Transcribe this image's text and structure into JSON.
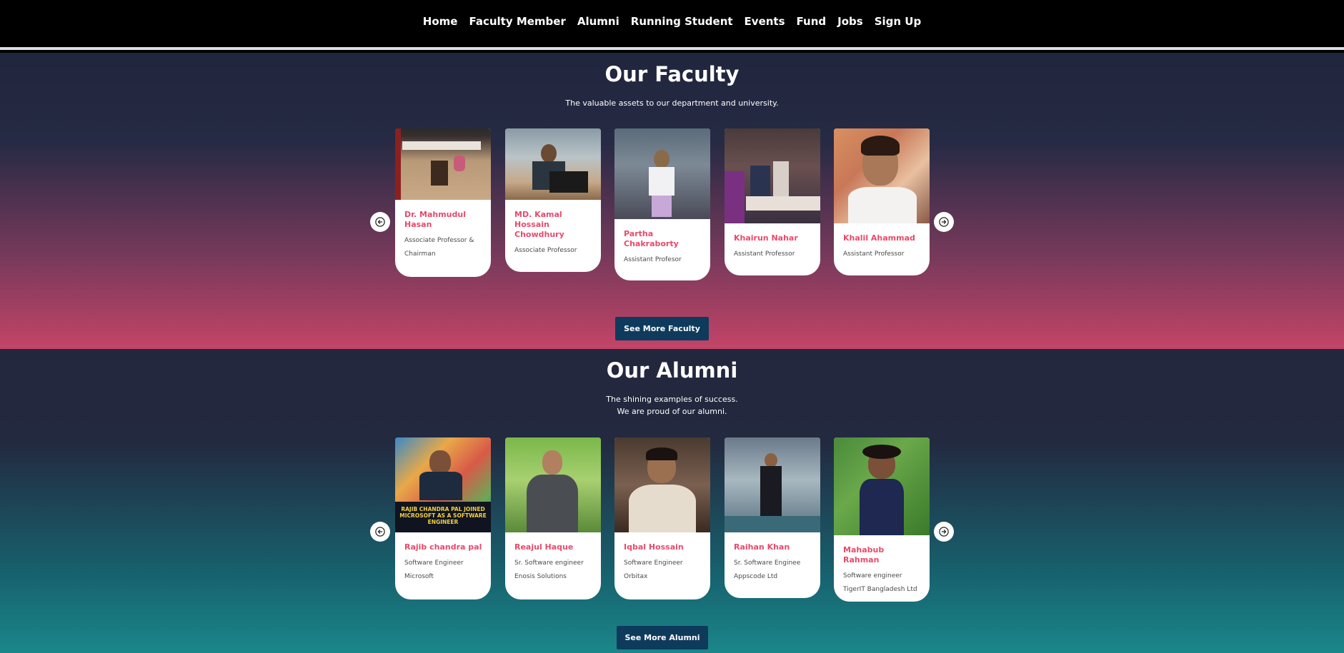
{
  "nav": {
    "items": [
      "Home",
      "Faculty Member",
      "Alumni",
      "Running Student",
      "Events",
      "Fund",
      "Jobs",
      "Sign Up"
    ]
  },
  "faculty": {
    "title": "Our Faculty",
    "subtitle": "The valuable assets to our department and university.",
    "members": [
      {
        "name": "Dr. Mahmudul Hasan",
        "role": "Associate Professor & Chairman"
      },
      {
        "name": "MD. Kamal Hossain Chowdhury",
        "role": "Associate Professor"
      },
      {
        "name": "Partha Chakraborty",
        "role": "Assistant Profesor"
      },
      {
        "name": "Khairun Nahar",
        "role": "Assistant Professor"
      },
      {
        "name": "Khalil Ahammad",
        "role": "Assistant Professor"
      }
    ],
    "button": "See More Faculty"
  },
  "alumni": {
    "title": "Our Alumni",
    "subtitle_line1": "The shining examples of success.",
    "subtitle_line2": "We are proud of our alumni.",
    "members": [
      {
        "name": "Rajib chandra pal",
        "role": "Software Engineer",
        "org": "Microsoft",
        "photo_caption": "RAJIB CHANDRA PAL JOINED MICROSOFT AS A SOFTWARE ENGINEER"
      },
      {
        "name": "Reajul Haque",
        "role": "Sr. Software engineer",
        "org": "Enosis Solutions"
      },
      {
        "name": "Iqbal Hossain",
        "role": "Software Engineer",
        "org": "Orbitax"
      },
      {
        "name": "Raihan Khan",
        "role": "Sr. Software Enginee",
        "org": "Appscode Ltd"
      },
      {
        "name": "Mahabub Rahman",
        "role": "Software engineer",
        "org": "TigerIT Bangladesh Ltd"
      }
    ],
    "button": "See More Alumni"
  },
  "colors": {
    "accent_name": "#e84a6b",
    "button_bg": "#0e3b5c"
  }
}
